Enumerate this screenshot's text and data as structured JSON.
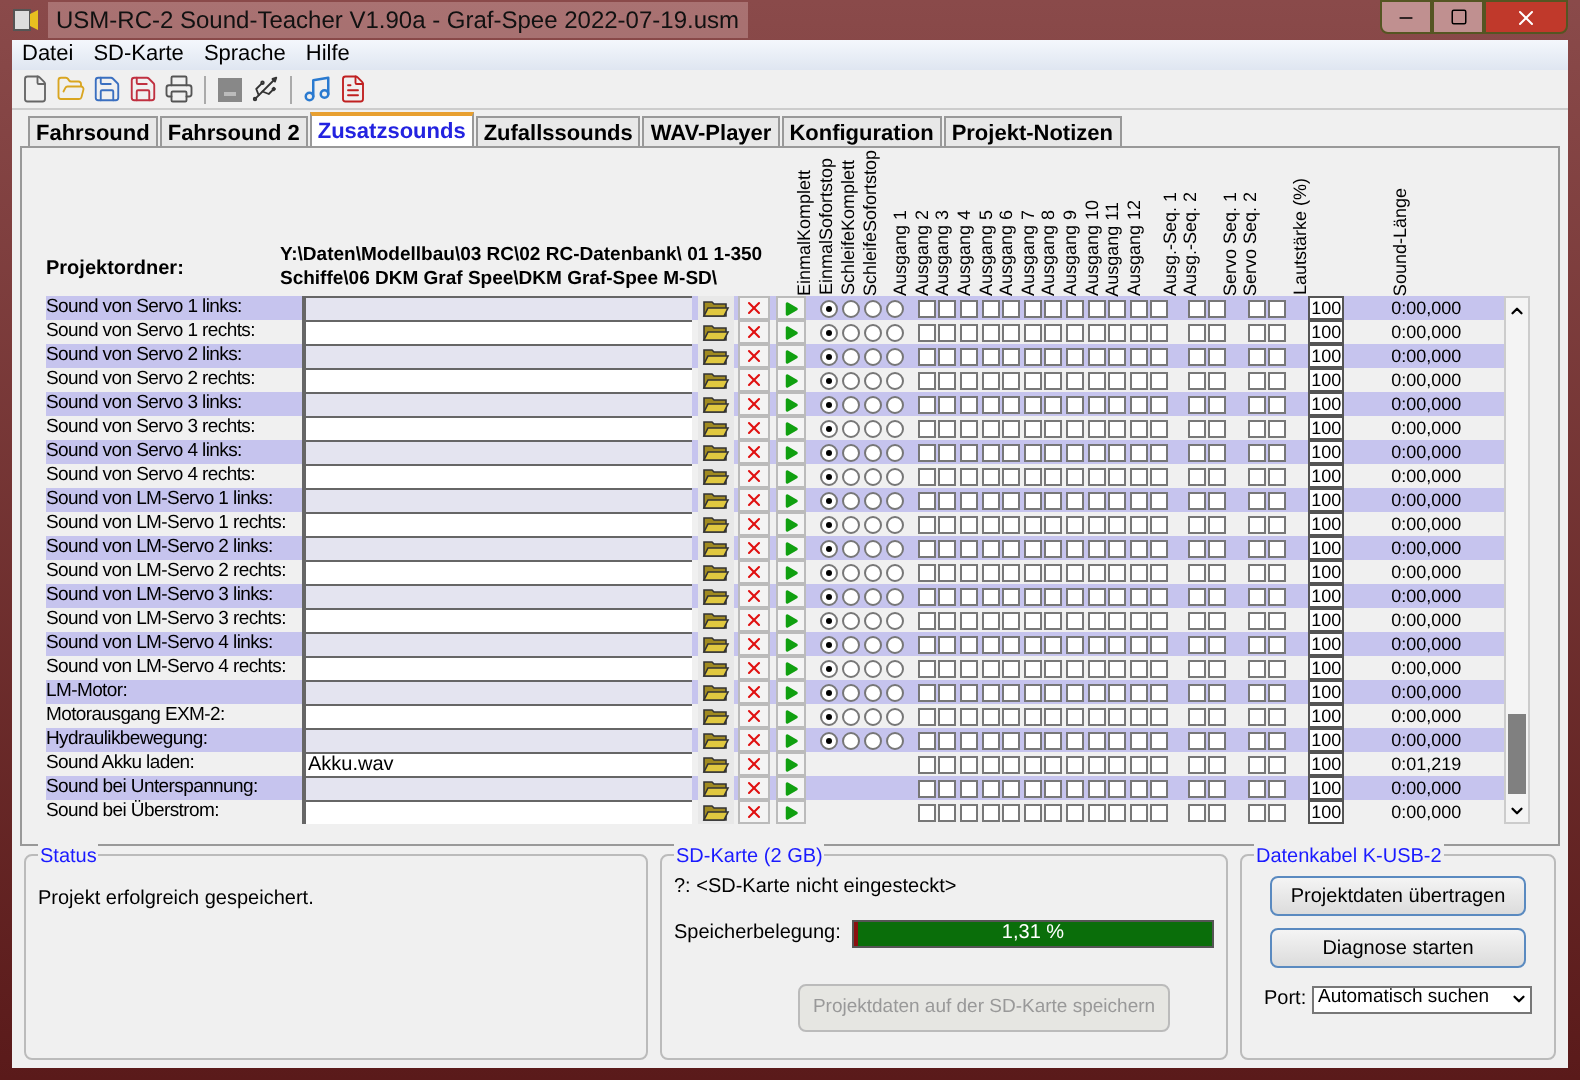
{
  "window": {
    "title": "USM-RC-2 Sound-Teacher V1.90a - Graf-Spee 2022-07-19.usm"
  },
  "menu": [
    "Datei",
    "SD-Karte",
    "Sprache",
    "Hilfe"
  ],
  "tabs": [
    {
      "label": "Fahrsound",
      "selected": false
    },
    {
      "label": "Fahrsound 2",
      "selected": false
    },
    {
      "label": "Zusatzsounds",
      "selected": true
    },
    {
      "label": "Zufallssounds",
      "selected": false
    },
    {
      "label": "WAV-Player",
      "selected": false
    },
    {
      "label": "Konfiguration",
      "selected": false
    },
    {
      "label": "Projekt-Notizen",
      "selected": false
    }
  ],
  "project": {
    "label": "Projektordner:",
    "path": "Y:\\Daten\\Modellbau\\03 RC\\02 RC-Datenbank\\ 01 1-350 Schiffe\\06 DKM Graf Spee\\DKM Graf-Spee M-SD\\"
  },
  "headers": {
    "modes": [
      "EinmalKomplett",
      "EinmalSofortstop",
      "SchleifeKomplett",
      "SchleifeSofortstop"
    ],
    "outputs": [
      "Ausgang 1",
      "Ausgang 2",
      "Ausgang 3",
      "Ausgang 4",
      "Ausgang 5",
      "Ausgang 6",
      "Ausgang 7",
      "Ausgang 8",
      "Ausgang 9",
      "Ausgang 10",
      "Ausgang 11",
      "Ausgang 12"
    ],
    "seq": [
      "Ausg.-Seq. 1",
      "Ausg.-Seq. 2"
    ],
    "servo": [
      "Servo Seq. 1",
      "Servo Seq. 2"
    ],
    "volume": "Lautstärke (%)",
    "length": "Sound-Länge"
  },
  "rows": [
    {
      "label": "Sound von Servo 1 links:",
      "modes": [
        {
          "selected": true
        },
        {
          "selected": false
        },
        {
          "selected": false
        },
        {
          "selected": false
        }
      ],
      "outputs": [
        false,
        false,
        false,
        false,
        false,
        false,
        false,
        false,
        false,
        false,
        false,
        false
      ],
      "seq": [
        false,
        false
      ],
      "servo": [
        false,
        false
      ],
      "volume": "100",
      "length": "0:00,000"
    },
    {
      "label": "Sound von Servo 1 rechts:",
      "modes": [
        {
          "selected": true
        },
        {
          "selected": false
        },
        {
          "selected": false
        },
        {
          "selected": false
        }
      ],
      "outputs": [
        false,
        false,
        false,
        false,
        false,
        false,
        false,
        false,
        false,
        false,
        false,
        false
      ],
      "seq": [
        false,
        false
      ],
      "servo": [
        false,
        false
      ],
      "volume": "100",
      "length": "0:00,000"
    },
    {
      "label": "Sound von Servo 2 links:",
      "modes": [
        {
          "selected": true
        },
        {
          "selected": false
        },
        {
          "selected": false
        },
        {
          "selected": false
        }
      ],
      "outputs": [
        false,
        false,
        false,
        false,
        false,
        false,
        false,
        false,
        false,
        false,
        false,
        false
      ],
      "seq": [
        false,
        false
      ],
      "servo": [
        false,
        false
      ],
      "volume": "100",
      "length": "0:00,000"
    },
    {
      "label": "Sound von Servo 2 rechts:",
      "modes": [
        {
          "selected": true
        },
        {
          "selected": false
        },
        {
          "selected": false
        },
        {
          "selected": false
        }
      ],
      "outputs": [
        false,
        false,
        false,
        false,
        false,
        false,
        false,
        false,
        false,
        false,
        false,
        false
      ],
      "seq": [
        false,
        false
      ],
      "servo": [
        false,
        false
      ],
      "volume": "100",
      "length": "0:00,000"
    },
    {
      "label": "Sound von Servo 3 links:",
      "modes": [
        {
          "selected": true
        },
        {
          "selected": false
        },
        {
          "selected": false
        },
        {
          "selected": false
        }
      ],
      "outputs": [
        false,
        false,
        false,
        false,
        false,
        false,
        false,
        false,
        false,
        false,
        false,
        false
      ],
      "seq": [
        false,
        false
      ],
      "servo": [
        false,
        false
      ],
      "volume": "100",
      "length": "0:00,000"
    },
    {
      "label": "Sound von Servo 3 rechts:",
      "modes": [
        {
          "selected": true
        },
        {
          "selected": false
        },
        {
          "selected": false
        },
        {
          "selected": false
        }
      ],
      "outputs": [
        false,
        false,
        false,
        false,
        false,
        false,
        false,
        false,
        false,
        false,
        false,
        false
      ],
      "seq": [
        false,
        false
      ],
      "servo": [
        false,
        false
      ],
      "volume": "100",
      "length": "0:00,000"
    },
    {
      "label": "Sound von Servo 4 links:",
      "modes": [
        {
          "selected": true
        },
        {
          "selected": false
        },
        {
          "selected": false
        },
        {
          "selected": false
        }
      ],
      "outputs": [
        false,
        false,
        false,
        false,
        false,
        false,
        false,
        false,
        false,
        false,
        false,
        false
      ],
      "seq": [
        false,
        false
      ],
      "servo": [
        false,
        false
      ],
      "volume": "100",
      "length": "0:00,000"
    },
    {
      "label": "Sound von Servo 4 rechts:",
      "modes": [
        {
          "selected": true
        },
        {
          "selected": false
        },
        {
          "selected": false
        },
        {
          "selected": false
        }
      ],
      "outputs": [
        false,
        false,
        false,
        false,
        false,
        false,
        false,
        false,
        false,
        false,
        false,
        false
      ],
      "seq": [
        false,
        false
      ],
      "servo": [
        false,
        false
      ],
      "volume": "100",
      "length": "0:00,000"
    },
    {
      "label": "Sound von LM-Servo 1 links:",
      "modes": [
        {
          "selected": true
        },
        {
          "selected": false
        },
        {
          "selected": false
        },
        {
          "selected": false
        }
      ],
      "outputs": [
        false,
        false,
        false,
        false,
        false,
        false,
        false,
        false,
        false,
        false,
        false,
        false
      ],
      "seq": [
        false,
        false
      ],
      "servo": [
        false,
        false
      ],
      "volume": "100",
      "length": "0:00,000"
    },
    {
      "label": "Sound von LM-Servo 1 rechts:",
      "modes": [
        {
          "selected": true
        },
        {
          "selected": false
        },
        {
          "selected": false
        },
        {
          "selected": false
        }
      ],
      "outputs": [
        false,
        false,
        false,
        false,
        false,
        false,
        false,
        false,
        false,
        false,
        false,
        false
      ],
      "seq": [
        false,
        false
      ],
      "servo": [
        false,
        false
      ],
      "volume": "100",
      "length": "0:00,000"
    },
    {
      "label": "Sound von LM-Servo 2 links:",
      "modes": [
        {
          "selected": true
        },
        {
          "selected": false
        },
        {
          "selected": false
        },
        {
          "selected": false
        }
      ],
      "outputs": [
        false,
        false,
        false,
        false,
        false,
        false,
        false,
        false,
        false,
        false,
        false,
        false
      ],
      "seq": [
        false,
        false
      ],
      "servo": [
        false,
        false
      ],
      "volume": "100",
      "length": "0:00,000"
    },
    {
      "label": "Sound von LM-Servo 2 rechts:",
      "modes": [
        {
          "selected": true
        },
        {
          "selected": false
        },
        {
          "selected": false
        },
        {
          "selected": false
        }
      ],
      "outputs": [
        false,
        false,
        false,
        false,
        false,
        false,
        false,
        false,
        false,
        false,
        false,
        false
      ],
      "seq": [
        false,
        false
      ],
      "servo": [
        false,
        false
      ],
      "volume": "100",
      "length": "0:00,000"
    },
    {
      "label": "Sound von LM-Servo 3 links:",
      "modes": [
        {
          "selected": true
        },
        {
          "selected": false
        },
        {
          "selected": false
        },
        {
          "selected": false
        }
      ],
      "outputs": [
        false,
        false,
        false,
        false,
        false,
        false,
        false,
        false,
        false,
        false,
        false,
        false
      ],
      "seq": [
        false,
        false
      ],
      "servo": [
        false,
        false
      ],
      "volume": "100",
      "length": "0:00,000"
    },
    {
      "label": "Sound von LM-Servo 3 rechts:",
      "modes": [
        {
          "selected": true
        },
        {
          "selected": false
        },
        {
          "selected": false
        },
        {
          "selected": false
        }
      ],
      "outputs": [
        false,
        false,
        false,
        false,
        false,
        false,
        false,
        false,
        false,
        false,
        false,
        false
      ],
      "seq": [
        false,
        false
      ],
      "servo": [
        false,
        false
      ],
      "volume": "100",
      "length": "0:00,000"
    },
    {
      "label": "Sound von LM-Servo 4 links:",
      "modes": [
        {
          "selected": true
        },
        {
          "selected": false
        },
        {
          "selected": false
        },
        {
          "selected": false
        }
      ],
      "outputs": [
        false,
        false,
        false,
        false,
        false,
        false,
        false,
        false,
        false,
        false,
        false,
        false
      ],
      "seq": [
        false,
        false
      ],
      "servo": [
        false,
        false
      ],
      "volume": "100",
      "length": "0:00,000"
    },
    {
      "label": "Sound von LM-Servo 4 rechts:",
      "modes": [
        {
          "selected": true
        },
        {
          "selected": false
        },
        {
          "selected": false
        },
        {
          "selected": false
        }
      ],
      "outputs": [
        false,
        false,
        false,
        false,
        false,
        false,
        false,
        false,
        false,
        false,
        false,
        false
      ],
      "seq": [
        false,
        false
      ],
      "servo": [
        false,
        false
      ],
      "volume": "100",
      "length": "0:00,000"
    },
    {
      "label": "LM-Motor:",
      "modes": [
        {
          "selected": true
        },
        {
          "selected": false
        },
        {
          "selected": false
        },
        {
          "selected": false
        }
      ],
      "outputs": [
        false,
        false,
        false,
        false,
        false,
        false,
        false,
        false,
        false,
        false,
        false,
        false
      ],
      "seq": [
        false,
        false
      ],
      "servo": [
        false,
        false
      ],
      "volume": "100",
      "length": "0:00,000"
    },
    {
      "label": "Motorausgang EXM-2:",
      "modes": [
        {
          "selected": true
        },
        {
          "selected": false
        },
        {
          "selected": false
        },
        {
          "selected": false
        }
      ],
      "outputs": [
        false,
        false,
        false,
        false,
        false,
        false,
        false,
        false,
        false,
        false,
        false,
        false
      ],
      "seq": [
        false,
        false
      ],
      "servo": [
        false,
        false
      ],
      "volume": "100",
      "length": "0:00,000"
    },
    {
      "label": "Hydraulikbewegung:",
      "modes": [
        {
          "selected": true
        },
        {
          "selected": false
        },
        {
          "selected": false
        },
        {
          "selected": false
        }
      ],
      "outputs": [
        false,
        false,
        false,
        false,
        false,
        false,
        false,
        false,
        false,
        false,
        false,
        false
      ],
      "seq": [
        false,
        false
      ],
      "servo": [
        false,
        false
      ],
      "volume": "100",
      "length": "0:00,000"
    },
    {
      "label": "Sound Akku laden:",
      "value": "Akku.wav",
      "outputs": [
        false,
        false,
        false,
        false,
        false,
        false,
        false,
        false,
        false,
        false,
        false,
        false
      ],
      "seq": [
        false,
        false
      ],
      "servo": [
        false,
        false
      ],
      "volume": "100",
      "length": "0:01,219"
    },
    {
      "label": "Sound bei Unterspannung:",
      "outputs": [
        false,
        false,
        false,
        false,
        false,
        false,
        false,
        false,
        false,
        false,
        false,
        false
      ],
      "seq": [
        false,
        false
      ],
      "servo": [
        false,
        false
      ],
      "volume": "100",
      "length": "0:00,000"
    },
    {
      "label": "Sound bei Überstrom:",
      "outputs": [
        false,
        false,
        false,
        false,
        false,
        false,
        false,
        false,
        false,
        false,
        false,
        false
      ],
      "seq": [
        false,
        false
      ],
      "servo": [
        false,
        false
      ],
      "volume": "100",
      "length": "0:00,000"
    }
  ],
  "status": {
    "title": "Status",
    "message": "Projekt erfolgreich gespeichert."
  },
  "sd": {
    "title": "SD-Karte (2 GB)",
    "drive": "?: <SD-Karte nicht eingesteckt>",
    "usage_label": "Speicherbelegung:",
    "level": 0.0131,
    "reading": "1,31 %",
    "button": {
      "label": "Projektdaten auf der SD-Karte speichern",
      "disabled": true
    }
  },
  "cable": {
    "title": "Datenkabel K-USB-2",
    "buttons": [
      "Projektdaten übertragen",
      "Diagnose starten"
    ],
    "port_label": "Port:",
    "port_value": "Automatisch suchen"
  }
}
